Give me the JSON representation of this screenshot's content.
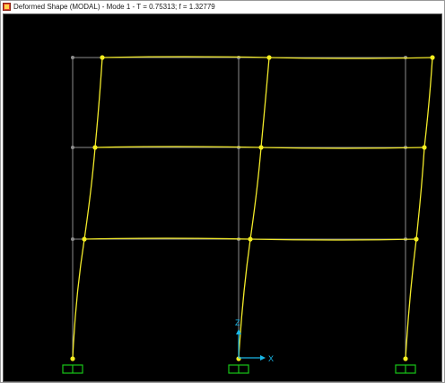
{
  "window": {
    "title": "Deformed Shape (MODAL) - Mode 1 - T = 0.75313;  f = 1.32779",
    "app_icon": "sap2000-app-icon"
  },
  "viewport": {
    "background": "#000000",
    "axes": {
      "z_label": "Z",
      "x_label": "X",
      "color": "#19b6e6"
    },
    "colors": {
      "undeformed": "#8c8c8c",
      "deformed": "#f2ea2a",
      "support": "#17c417",
      "joint": "#f5ee1f",
      "undeformed_joint": "#8c8c8c"
    },
    "icons": [
      "fixed-support-icon",
      "axis-triad-icon",
      "joint-icon"
    ]
  }
}
